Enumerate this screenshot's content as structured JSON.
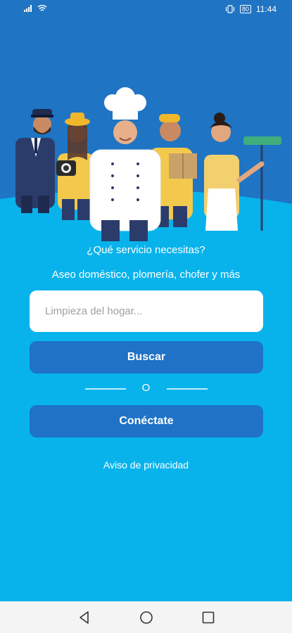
{
  "status_bar": {
    "time": "11:44",
    "battery_label": "80"
  },
  "hero": {
    "illustration": "group of workers: pilot, photographer, chef, delivery person, cleaner"
  },
  "main": {
    "question": "¿Qué servicio necesitas?",
    "subtitle": "Aseo doméstico, plomería, chofer y más",
    "search_placeholder": "Limpieza del hogar...",
    "search_button": "Buscar",
    "divider_text": "O",
    "connect_button": "Conéctate",
    "privacy_link": "Aviso de privacidad"
  },
  "nav": {
    "back_icon": "back-triangle-icon",
    "home_icon": "home-circle-icon",
    "recents_icon": "recents-square-icon"
  },
  "colors": {
    "background": "#08b3ec",
    "hero_blue": "#1f74c3",
    "button": "#1f72c6"
  }
}
